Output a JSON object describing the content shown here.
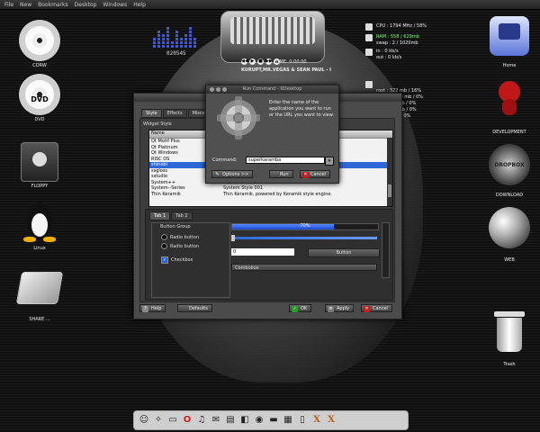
{
  "menubar": [
    "File",
    "New",
    "Bookmarks",
    "Desktop",
    "Windows",
    "Help"
  ],
  "desktop_left": [
    {
      "label": "CDRW",
      "icon": "cd-icon"
    },
    {
      "label": "DVD",
      "icon": "dvd-icon",
      "badge": "DVD"
    },
    {
      "label": "FLOPPY",
      "icon": "floppy-icon"
    },
    {
      "label": "Linux",
      "icon": "tux-icon"
    },
    {
      "label": "SHARE ...",
      "icon": "share-icon"
    }
  ],
  "desktop_right": [
    {
      "label": "Home",
      "icon": "home-icon"
    },
    {
      "label": "DEVELOPMENT",
      "icon": "devil-icon"
    },
    {
      "label": "DOWNLOAD",
      "icon": "dropbox-icon",
      "badge": "DROPBOX"
    },
    {
      "label": "WEB",
      "icon": "globe-icon"
    },
    {
      "label": "Trash",
      "icon": "trash-icon"
    }
  ],
  "clock": "020545",
  "player": {
    "time_label": "TIME: 0:00:00",
    "track": "KURUPT,MR.VEGAS & SEAN PAUL - I",
    "buttons": [
      "◀◀",
      "▶",
      "■",
      "▶▶",
      "▲"
    ]
  },
  "sysmon": {
    "cpu": "CPU : 1794 MHz / 58%",
    "ram": "RAM : 558 / 629mb",
    "swap": "swap : 2 / 1020mb",
    "net_in": "in : 0 kb/s",
    "net_out": "out : 0 kb/s",
    "disks": [
      "root : 322 mb / 16%",
      "windows : 0 mb / 0%",
      "share : 0 mb / 0%",
      "home : 0 mb / 0%",
      "usr : 0 mb / 0%"
    ]
  },
  "kde_window": {
    "tabs": [
      "Style",
      "Effects",
      "Miscellaneous"
    ],
    "widget_style_label": "Widget Style",
    "list_header": "Name",
    "rows": [
      {
        "name": "Qt Motif Plus",
        "desc": ""
      },
      {
        "name": "Qt Platinum",
        "desc": ""
      },
      {
        "name": "Qt Windows",
        "desc": ""
      },
      {
        "name": "RISC OS",
        "desc": ""
      },
      {
        "name": "shinobi",
        "desc": "",
        "selected": true
      },
      {
        "name": "ssgloss",
        "desc": ""
      },
      {
        "name": "sstudio",
        "desc": ""
      },
      {
        "name": "System++",
        "desc": ""
      },
      {
        "name": "System--Series",
        "desc": "System Style 001"
      },
      {
        "name": "Thin Keramik",
        "desc": "Thin Keramik, powered by Keramik style engine."
      }
    ],
    "preview_tabs": [
      "Tab 1",
      "Tab 2"
    ],
    "button_group": "Button Group",
    "radio1": "Radio button",
    "radio2": "Radio button",
    "checkbox": "Checkbox",
    "progress_pct": 70,
    "progress_label": "70%",
    "spin_value": "0",
    "button_label": "Button",
    "combo_label": "Combobox",
    "help": "Help",
    "defaults": "Defaults",
    "ok": "OK",
    "apply": "Apply",
    "cancel": "Cancel"
  },
  "run_dialog": {
    "title": "Run Command - KDesktop",
    "message": "Enter the name of the application you want to run or the URL you want to view.",
    "command_label": "Command:",
    "command_value": "superkaramba",
    "options": "Options >>",
    "run": "Run",
    "cancel": "Cancel"
  },
  "dock_icons": [
    "finder-icon",
    "safari-icon",
    "monitor-icon",
    "opera-icon",
    "music-icon",
    "notes-icon",
    "film-icon",
    "app-icon",
    "camera-icon",
    "terminal-icon",
    "calendar-icon",
    "trash-icon",
    "x-icon",
    "x-icon"
  ],
  "colors": {
    "accent": "#2f68d6",
    "ram_green": "#7aff7a"
  }
}
